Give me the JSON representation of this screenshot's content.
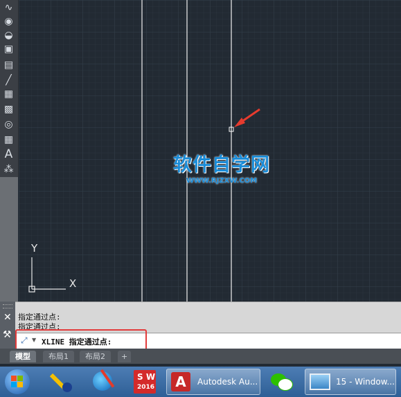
{
  "toolbar": {
    "tools": [
      "spline-icon",
      "ellipse-icon",
      "ellipse-arc-icon",
      "insert-block-icon",
      "make-block-icon",
      "point-icon",
      "hatch-icon",
      "gradient-icon",
      "region-icon",
      "table-icon",
      "text-icon",
      "add-selected-icon"
    ],
    "text_tool_glyph": "A"
  },
  "drawing": {
    "background": "#222a33",
    "watermark_title": "软件自学网",
    "watermark_url": "WWW.RJZXW.COM",
    "ucs_x": "X",
    "ucs_y": "Y"
  },
  "command": {
    "history": [
      "指定通过点:",
      "指定通过点:"
    ],
    "current": "XLINE 指定通过点:",
    "close_glyph": "✕"
  },
  "tabs": [
    "模型",
    "布局1",
    "布局2",
    "+"
  ],
  "taskbar": {
    "apps": [
      {
        "icon": "windows-start-icon"
      },
      {
        "icon": "guitar-app-icon"
      },
      {
        "icon": "globe-app-icon"
      },
      {
        "icon": "solidworks-2016-icon",
        "label": "2016"
      },
      {
        "icon": "autocad-icon",
        "label": "Autodesk Au..."
      },
      {
        "icon": "wechat-icon"
      },
      {
        "icon": "photo-viewer-icon",
        "label": "15 - Window..."
      }
    ]
  }
}
